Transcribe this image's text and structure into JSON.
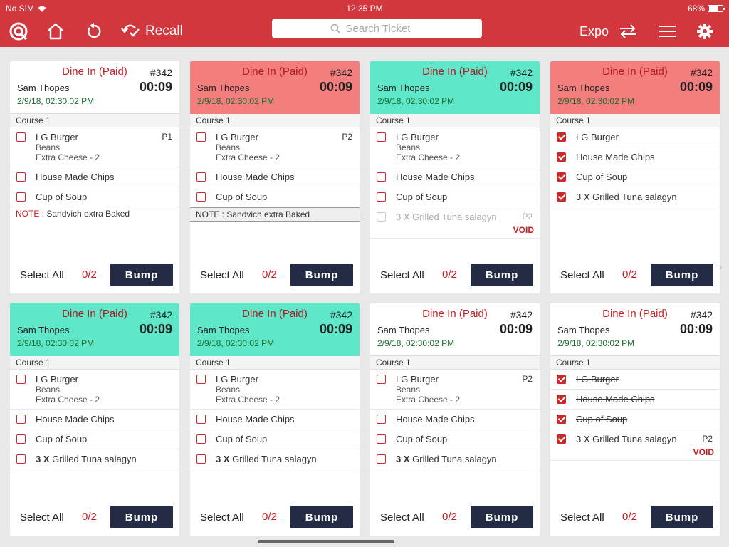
{
  "status_bar": {
    "carrier": "No SIM",
    "time": "12:35 PM",
    "battery": "68%",
    "battery_level": 0.68
  },
  "toolbar": {
    "recall_label": "Recall",
    "search_placeholder": "Search Ticket",
    "expo_label": "Expo"
  },
  "colors": {
    "accent_red": "#d1373d",
    "head_red": "#f47d7d",
    "head_green": "#5ee8c9",
    "bump_navy": "#232b45"
  },
  "cards": [
    {
      "order_type": "Dine In (Paid)",
      "ticket": "#342",
      "customer": "Sam Thopes",
      "timer": "00:09",
      "datetime": "2/9/18,  02:30:02 PM",
      "header_color": "white",
      "course": "Course 1",
      "items": [
        {
          "name": "LG Burger",
          "modifiers": [
            "Beans",
            "Extra Cheese - 2"
          ],
          "priority": "P1",
          "checked": false
        },
        {
          "name": "House Made Chips",
          "checked": false
        },
        {
          "name": "Cup of Soup",
          "checked": false
        }
      ],
      "note_label": "NOTE :",
      "note": "Sandvich extra Baked",
      "select_all": "Select All",
      "count": "0/2",
      "bump": "Bump"
    },
    {
      "order_type": "Dine In (Paid)",
      "ticket": "#342",
      "customer": "Sam Thopes",
      "timer": "00:09",
      "datetime": "2/9/18,  02:30:02 PM",
      "header_color": "red",
      "course": "Course 1",
      "items": [
        {
          "name": "LG Burger",
          "modifiers": [
            "Beans",
            "Extra Cheese - 2"
          ],
          "priority": "P2",
          "checked": false
        },
        {
          "name": "House Made Chips",
          "checked": false
        },
        {
          "name": "Cup of Soup",
          "checked": false
        }
      ],
      "note_bar": "NOTE :  Sandvich extra Baked",
      "select_all": "Select All",
      "count": "0/2",
      "bump": "Bump"
    },
    {
      "order_type": "Dine In (Paid)",
      "ticket": "#342",
      "customer": "Sam Thopes",
      "timer": "00:09",
      "datetime": "2/9/18,  02:30:02 PM",
      "header_color": "green",
      "course": "Course 1",
      "items": [
        {
          "name": "LG Burger",
          "modifiers": [
            "Beans",
            "Extra Cheese - 2"
          ],
          "checked": false
        },
        {
          "name": "House Made Chips",
          "checked": false
        },
        {
          "name": "Cup of Soup",
          "checked": false
        },
        {
          "name": "3 X Grilled Tuna salagyn",
          "priority": "P2",
          "void": "VOID",
          "faded": true,
          "checked": false
        }
      ],
      "select_all": "Select All",
      "count": "0/2",
      "bump": "Bump"
    },
    {
      "order_type": "Dine In (Paid)",
      "ticket": "#342",
      "customer": "Sam Thopes",
      "timer": "00:09",
      "datetime": "2/9/18,  02:30:02 PM",
      "header_color": "red",
      "course": "Course 1",
      "items": [
        {
          "name": "LG Burger",
          "checked": true,
          "struck": true
        },
        {
          "name": "House Made Chips",
          "checked": true,
          "struck": true
        },
        {
          "name": "Cup of Soup",
          "checked": true,
          "struck": true
        },
        {
          "name": "3 X Grilled Tuna salagyn",
          "checked": true,
          "struck": true
        }
      ],
      "select_all": "Select All",
      "count": "0/2",
      "bump": "Bump"
    },
    {
      "order_type": "Dine In (Paid)",
      "ticket": "#342",
      "customer": "Sam Thopes",
      "timer": "00:09",
      "datetime": "2/9/18,  02:30:02 PM",
      "header_color": "green",
      "course": "Course 1",
      "items": [
        {
          "name": "LG Burger",
          "modifiers": [
            "Beans",
            "Extra Cheese - 2"
          ],
          "checked": false
        },
        {
          "name": "House Made Chips",
          "checked": false
        },
        {
          "name": "Cup of Soup",
          "checked": false
        },
        {
          "qty": "3 X",
          "name": "Grilled Tuna salagyn",
          "checked": false
        }
      ],
      "select_all": "Select All",
      "count": "0/2",
      "bump": "Bump"
    },
    {
      "order_type": "Dine In (Paid)",
      "ticket": "#342",
      "customer": "Sam Thopes",
      "timer": "00:09",
      "datetime": "2/9/18,  02:30:02 PM",
      "header_color": "green",
      "course": "Course 1",
      "items": [
        {
          "name": "LG Burger",
          "modifiers": [
            "Beans",
            "Extra Cheese - 2"
          ],
          "checked": false
        },
        {
          "name": "House Made Chips",
          "checked": false
        },
        {
          "name": "Cup of Soup",
          "checked": false
        },
        {
          "qty": "3 X",
          "name": "Grilled Tuna salagyn",
          "checked": false
        }
      ],
      "select_all": "Select All",
      "count": "0/2",
      "bump": "Bump"
    },
    {
      "order_type": "Dine In (Paid)",
      "ticket": "#342",
      "customer": "Sam Thopes",
      "timer": "00:09",
      "datetime": "2/9/18,  02:30:02 PM",
      "header_color": "white",
      "course": "Course 1",
      "items": [
        {
          "name": "LG Burger",
          "modifiers": [
            "Beans",
            "Extra Cheese - 2"
          ],
          "priority": "P2",
          "checked": false
        },
        {
          "name": "House Made Chips",
          "checked": false
        },
        {
          "name": "Cup of Soup",
          "checked": false
        },
        {
          "qty": "3 X",
          "name": "Grilled Tuna salagyn",
          "checked": false
        }
      ],
      "select_all": "Select All",
      "count": "0/2",
      "bump": "Bump"
    },
    {
      "order_type": "Dine In (Paid)",
      "ticket": "#342",
      "customer": "Sam Thopes",
      "timer": "00:09",
      "datetime": "2/9/18,  02:30:02 PM",
      "header_color": "white",
      "course": "Course 1",
      "items": [
        {
          "name": "LG Burger",
          "checked": true,
          "struck": true
        },
        {
          "name": "House Made Chips",
          "checked": true,
          "struck": true
        },
        {
          "name": "Cup of Soup",
          "checked": true,
          "struck": true
        },
        {
          "name": "3 X Grilled Tuna salagyn",
          "priority": "P2",
          "void": "VOID",
          "checked": true,
          "struck": true
        }
      ],
      "select_all": "Select All",
      "count": "0/2",
      "bump": "Bump"
    }
  ]
}
